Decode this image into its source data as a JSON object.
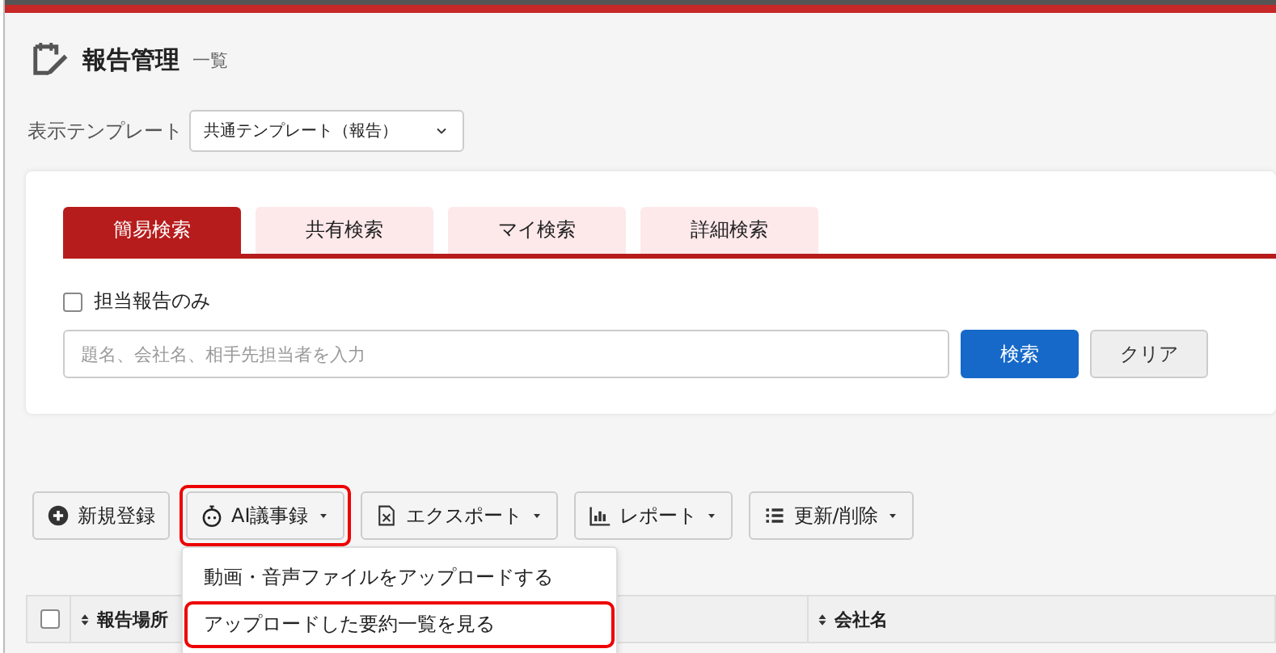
{
  "header": {
    "title": "報告管理",
    "subtitle": "一覧"
  },
  "template": {
    "label": "表示テンプレート",
    "value": "共通テンプレート（報告）"
  },
  "search": {
    "tabs": [
      {
        "label": "簡易検索",
        "selected": true
      },
      {
        "label": "共有検索",
        "selected": false
      },
      {
        "label": "マイ検索",
        "selected": false
      },
      {
        "label": "詳細検索",
        "selected": false
      }
    ],
    "only_mine": {
      "label": "担当報告のみ",
      "checked": false
    },
    "placeholder": "題名、会社名、相手先担当者を入力",
    "buttons": [
      {
        "label": "検索",
        "kind": "primary"
      },
      {
        "label": "クリア",
        "kind": "plain"
      }
    ]
  },
  "toolbar": [
    {
      "label": "新規登録",
      "kind": "add",
      "caret": false,
      "highlighted": false
    },
    {
      "label": "AI議事録",
      "kind": "ai",
      "caret": true,
      "highlighted": true
    },
    {
      "label": "エクスポート",
      "kind": "export",
      "caret": true,
      "highlighted": false
    },
    {
      "label": "レポート",
      "kind": "report",
      "caret": true,
      "highlighted": false
    },
    {
      "label": "更新/削除",
      "kind": "bulk",
      "caret": true,
      "highlighted": false
    }
  ],
  "menu": [
    {
      "label": "動画・音声ファイルをアップロードする",
      "highlighted": false
    },
    {
      "label": "アップロードした要約一覧を見る",
      "highlighted": true
    }
  ],
  "table": {
    "select_all": {
      "checked": false
    },
    "columns": [
      {
        "label": "報告場所",
        "sortable": true
      },
      {
        "label": "会社名",
        "sortable": true
      }
    ]
  }
}
